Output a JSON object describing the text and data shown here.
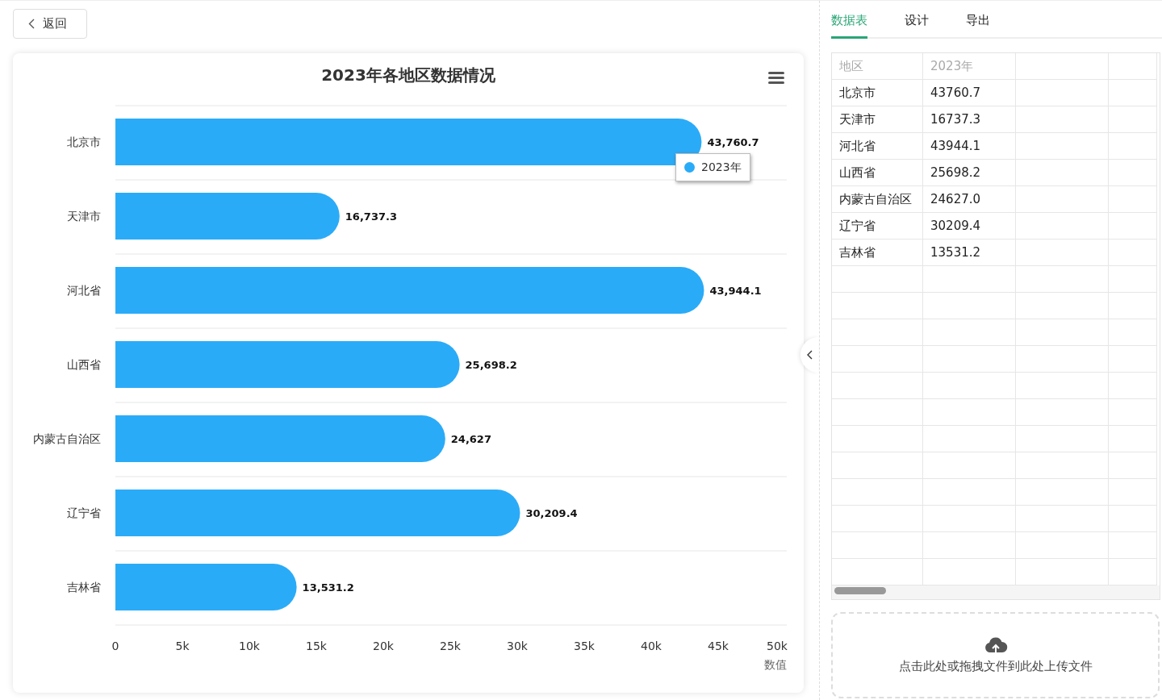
{
  "back_button": {
    "label": "返回"
  },
  "chart": {
    "chart_data": {
      "type": "bar",
      "orientation": "horizontal",
      "title": "2023年各地区数据情况",
      "xlabel": "数值",
      "categories": [
        "北京市",
        "天津市",
        "河北省",
        "山西省",
        "内蒙古自治区",
        "辽宁省",
        "吉林省"
      ],
      "series": [
        {
          "name": "2023年",
          "color": "#2aabf8",
          "values": [
            43760.7,
            16737.3,
            43944.1,
            25698.2,
            24627,
            30209.4,
            13531.2
          ]
        }
      ],
      "value_labels": [
        "43,760.7",
        "16,737.3",
        "43,944.1",
        "25,698.2",
        "24,627",
        "30,209.4",
        "13,531.2"
      ],
      "xlim": [
        0,
        50000
      ],
      "xticks": [
        {
          "value": 0,
          "label": "0"
        },
        {
          "value": 5000,
          "label": "5k"
        },
        {
          "value": 10000,
          "label": "10k"
        },
        {
          "value": 15000,
          "label": "15k"
        },
        {
          "value": 20000,
          "label": "20k"
        },
        {
          "value": 25000,
          "label": "25k"
        },
        {
          "value": 30000,
          "label": "30k"
        },
        {
          "value": 35000,
          "label": "35k"
        },
        {
          "value": 40000,
          "label": "40k"
        },
        {
          "value": 45000,
          "label": "45k"
        },
        {
          "value": 50000,
          "label": "50k"
        }
      ]
    }
  },
  "tabs": [
    {
      "label": "数据表",
      "selected": true
    },
    {
      "label": "设计",
      "selected": false
    },
    {
      "label": "导出",
      "selected": false
    }
  ],
  "table": {
    "columns": [
      "地区",
      "2023年"
    ],
    "rows": [
      [
        "北京市",
        "43760.7"
      ],
      [
        "天津市",
        "16737.3"
      ],
      [
        "河北省",
        "43944.1"
      ],
      [
        "山西省",
        "25698.2"
      ],
      [
        "内蒙古自治区",
        "24627.0"
      ],
      [
        "辽宁省",
        "30209.4"
      ],
      [
        "吉林省",
        "13531.2"
      ]
    ]
  },
  "upload": {
    "text": "点击此处或拖拽文件到此处上传文件"
  }
}
